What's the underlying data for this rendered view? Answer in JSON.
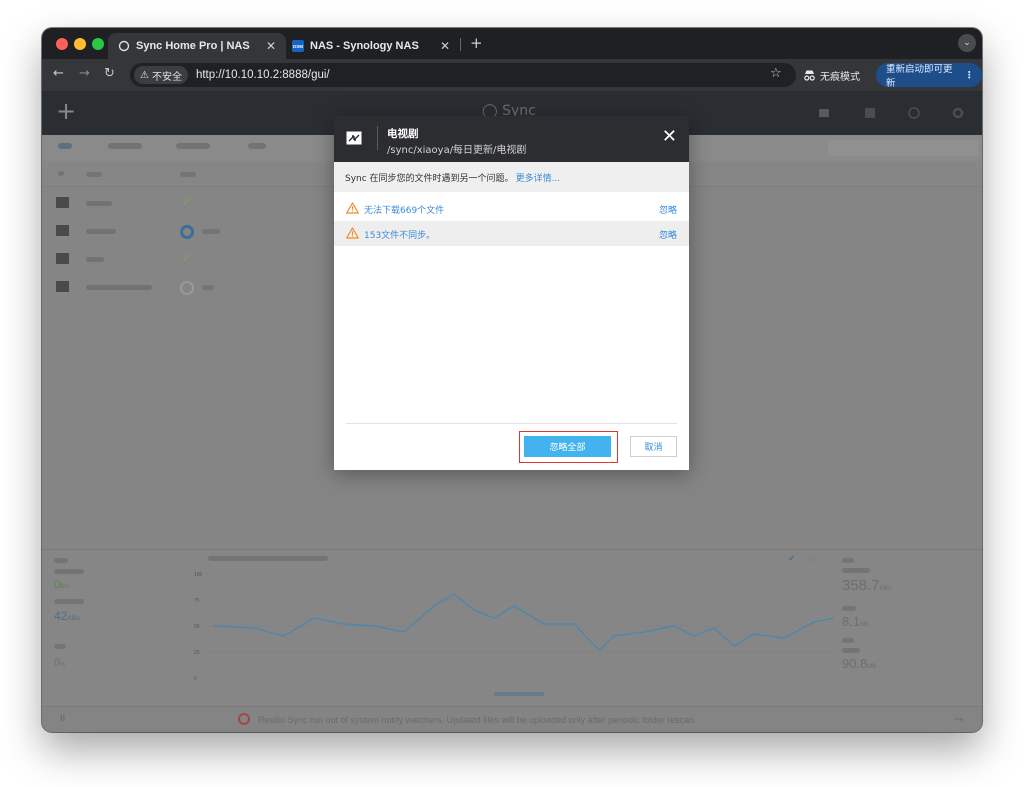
{
  "browser": {
    "tabs": [
      {
        "title": "Sync Home Pro | NAS",
        "active": true
      },
      {
        "title": "NAS - Synology NAS",
        "favicon_text": "DSM",
        "active": false
      }
    ],
    "security_label": "不安全",
    "url": "http://10.10.10.2:8888/gui/",
    "incognito_label": "无痕模式",
    "relaunch_label": "重新启动即可更新"
  },
  "app": {
    "brand": "Sync",
    "status_message": "Resilio Sync run out of system notify watchers. Updated files will be uploaded only after periodic folder rescan"
  },
  "dialog": {
    "title": "电视剧",
    "path": "/sync/xiaoya/每日更新/电视剧",
    "info_text": "Sync 在同步您的文件时遇到另一个问题。",
    "info_link": "更多详情...",
    "issues": [
      {
        "text": "无法下载669个文件",
        "action": "忽略"
      },
      {
        "text": "153文件不同步。",
        "action": "忽略"
      }
    ],
    "ignore_all_label": "忽略全部",
    "cancel_label": "取消"
  },
  "stats": {
    "big_values": [
      {
        "value": "358.7",
        "unit": "KB/s"
      },
      {
        "value": "8.1",
        "unit": "MB"
      },
      {
        "value": "90.8",
        "unit": "MB"
      }
    ],
    "left_values": [
      {
        "value": "0",
        "unit": "B/s"
      },
      {
        "value": "42",
        "unit": "KB/s"
      },
      {
        "value": "0",
        "unit": "%"
      }
    ],
    "y_ticks": [
      "100",
      "75",
      "50",
      "25",
      "0"
    ]
  },
  "colors": {
    "accent": "#42b3ef",
    "link": "#3a8ad8",
    "warning": "#f08a24",
    "highlight_border": "#e2362e"
  }
}
